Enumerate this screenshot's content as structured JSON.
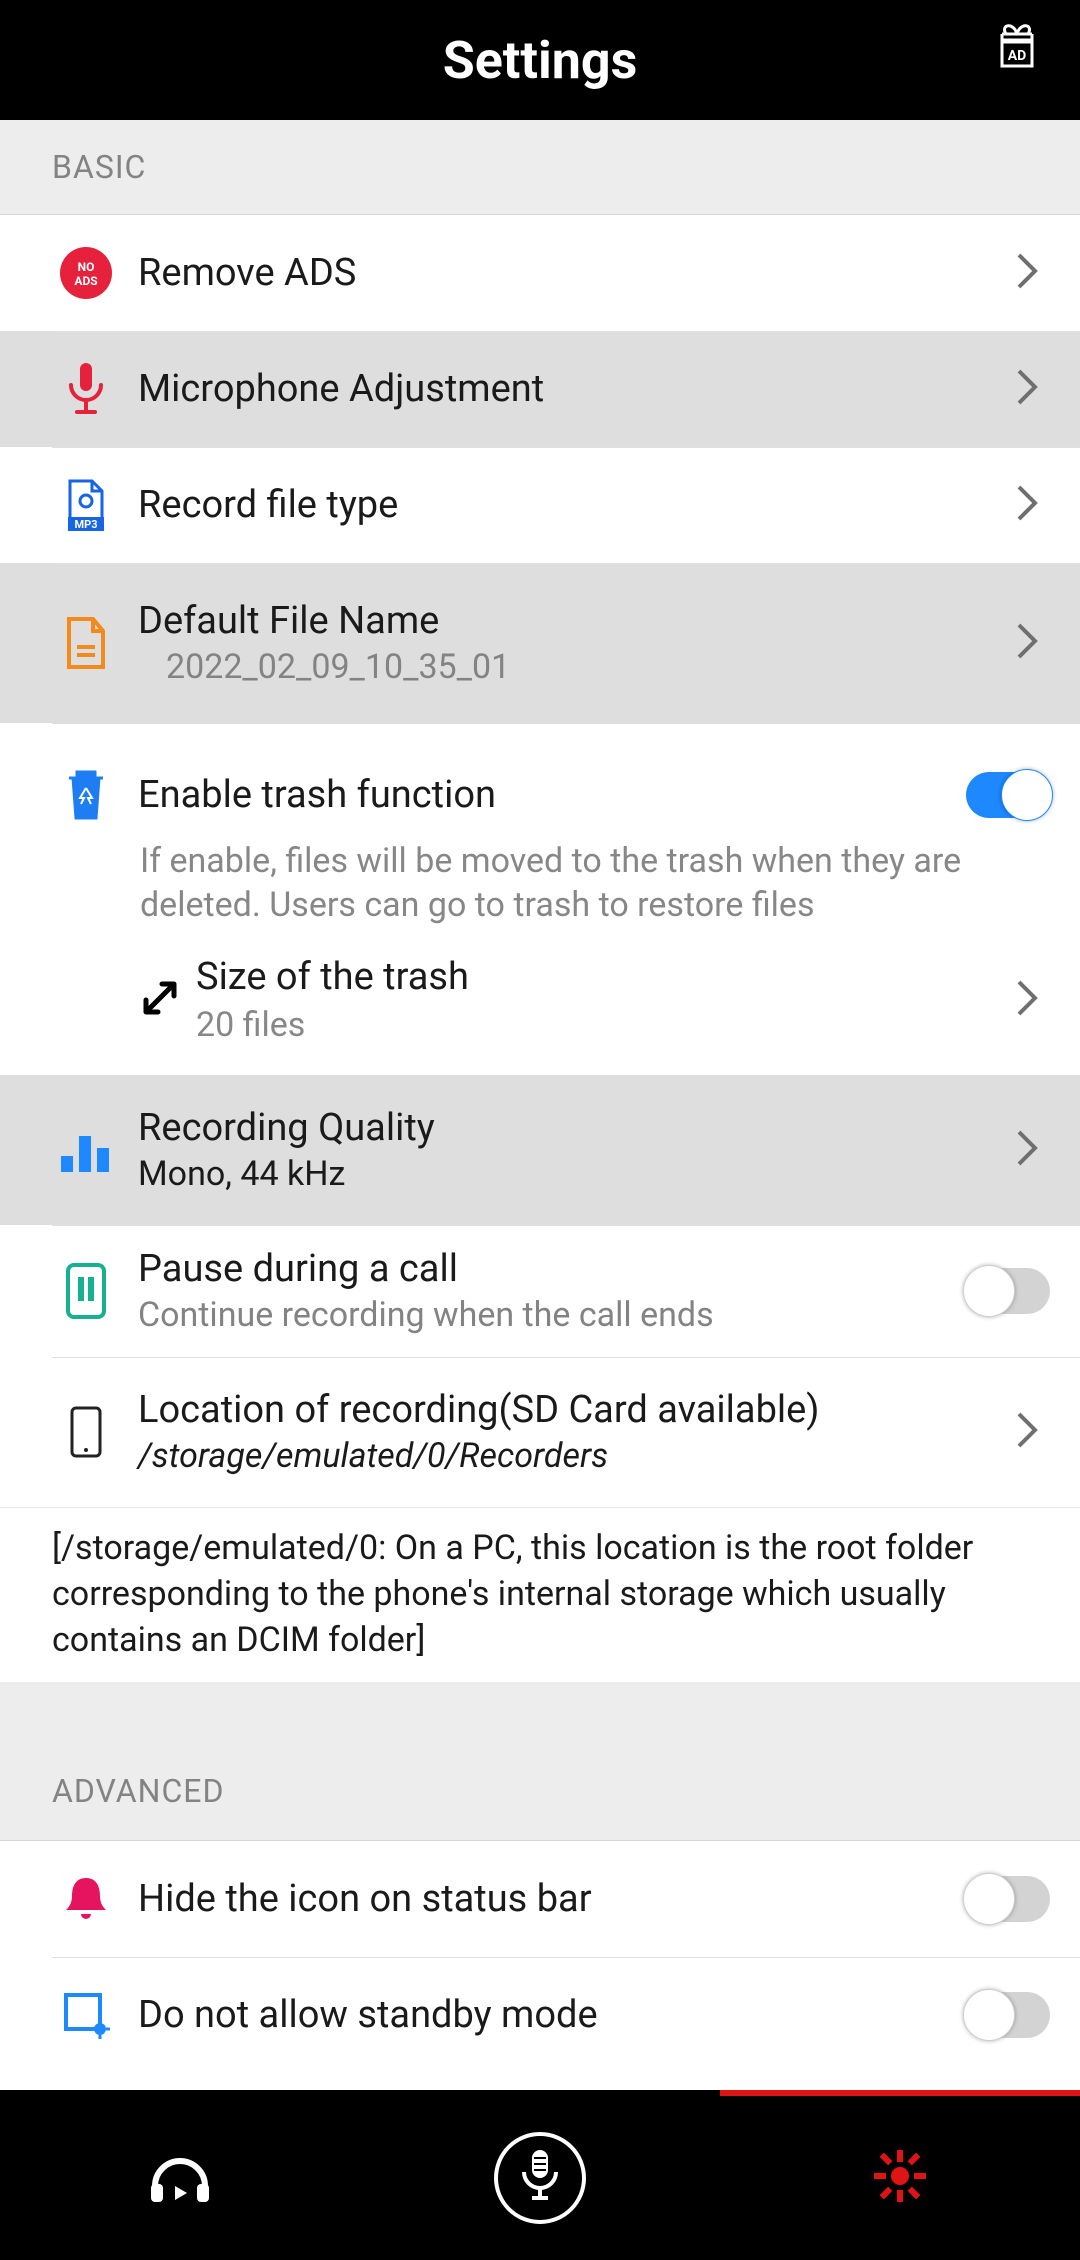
{
  "header": {
    "title": "Settings"
  },
  "sections": {
    "basic": "BASIC",
    "advanced": "ADVANCED"
  },
  "items": {
    "remove_ads": {
      "title": "Remove ADS"
    },
    "mic_adjust": {
      "title": "Microphone Adjustment"
    },
    "record_type": {
      "title": "Record file type"
    },
    "default_name": {
      "title": "Default File Name",
      "value": "2022_02_09_10_35_01"
    },
    "trash": {
      "title": "Enable trash function",
      "desc": "If enable, files will be moved to the trash when they are deleted. Users can go to trash to restore files",
      "size_title": "Size of the trash",
      "size_value": "20 files",
      "enabled": true
    },
    "quality": {
      "title": "Recording Quality",
      "value": "Mono,  44 kHz"
    },
    "pause_call": {
      "title": "Pause during a call",
      "subtitle": "Continue recording when the call ends",
      "enabled": false
    },
    "location": {
      "title": "Location of recording(SD Card available)",
      "path": "/storage/emulated/0/Recorders"
    },
    "location_note": "[/storage/emulated/0: On a PC, this location is the root folder corresponding to the phone's internal storage which usually contains an DCIM folder]",
    "hide_icon": {
      "title": "Hide the icon on status bar",
      "enabled": false
    },
    "no_standby": {
      "title": "Do not allow standby mode",
      "enabled": false
    }
  }
}
